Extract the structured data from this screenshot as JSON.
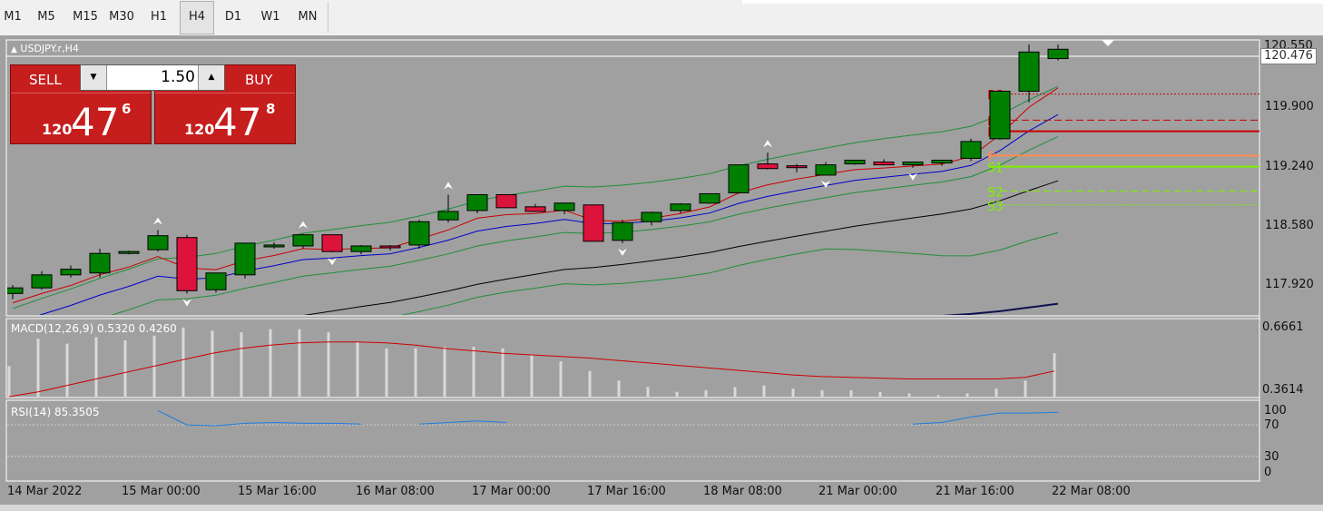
{
  "timeframes": [
    "M1",
    "M5",
    "M15",
    "M30",
    "H1",
    "H4",
    "D1",
    "W1",
    "MN"
  ],
  "active_timeframe": "H4",
  "chart": {
    "symbol_title": "USDJPY.r,H4",
    "current_price": "120.476",
    "top_price_partial": "120.550",
    "price_ticks": [
      "119.900",
      "119.240",
      "118.580",
      "117.920"
    ],
    "time_labels": [
      "14 Mar 2022",
      "15 Mar 00:00",
      "15 Mar 16:00",
      "16 Mar 08:00",
      "17 Mar 00:00",
      "17 Mar 16:00",
      "18 Mar 08:00",
      "21 Mar 00:00",
      "21 Mar 16:00",
      "22 Mar 08:00"
    ],
    "pivots": [
      "R3",
      "R2",
      "R1",
      "P",
      "S1",
      "S2",
      "S3"
    ]
  },
  "trade_panel": {
    "sell_label": "SELL",
    "buy_label": "BUY",
    "lot_size": "1.50",
    "sell_price_prefix": "120",
    "sell_price_big": "47",
    "sell_price_sup": "6",
    "buy_price_prefix": "120",
    "buy_price_big": "47",
    "buy_price_sup": "8"
  },
  "macd": {
    "label": "MACD(12,26,9) 0.5320 0.4260",
    "ticks": [
      "0.6661",
      "0.3614"
    ]
  },
  "rsi": {
    "label": "RSI(14) 85.3505",
    "ticks": [
      "100",
      "70",
      "30",
      "0"
    ]
  },
  "colors": {
    "bull": "#008000",
    "bear": "#dc143c",
    "background": "#a0a0a0",
    "accent": "#c61d1d"
  },
  "chart_data": {
    "type": "candlestick",
    "symbol": "USDJPY.r",
    "timeframe": "H4",
    "ohlc": [
      [
        117.88,
        117.97,
        117.82,
        117.94
      ],
      [
        117.94,
        118.12,
        117.92,
        118.08
      ],
      [
        118.08,
        118.18,
        118.05,
        118.14
      ],
      [
        118.1,
        118.36,
        118.05,
        118.31
      ],
      [
        118.31,
        118.34,
        118.3,
        118.33
      ],
      [
        118.35,
        118.56,
        118.33,
        118.5
      ],
      [
        118.48,
        118.51,
        117.88,
        117.91
      ],
      [
        117.92,
        118.08,
        117.89,
        118.1
      ],
      [
        118.08,
        118.42,
        118.04,
        118.42
      ],
      [
        118.38,
        118.43,
        118.36,
        118.4
      ],
      [
        118.39,
        118.52,
        118.36,
        118.51
      ],
      [
        118.51,
        118.51,
        118.32,
        118.33
      ],
      [
        118.33,
        118.4,
        118.3,
        118.39
      ],
      [
        118.39,
        118.4,
        118.34,
        118.38
      ],
      [
        118.4,
        118.67,
        118.36,
        118.65
      ],
      [
        118.67,
        118.94,
        118.64,
        118.76
      ],
      [
        118.77,
        118.94,
        118.74,
        118.94
      ],
      [
        118.94,
        118.94,
        118.8,
        118.8
      ],
      [
        118.81,
        118.84,
        118.76,
        118.76
      ],
      [
        118.77,
        118.85,
        118.73,
        118.85
      ],
      [
        118.83,
        118.82,
        118.47,
        118.44
      ],
      [
        118.45,
        118.67,
        118.42,
        118.64
      ],
      [
        118.65,
        118.76,
        118.61,
        118.75
      ],
      [
        118.77,
        118.85,
        118.74,
        118.84
      ],
      [
        118.85,
        118.95,
        118.84,
        118.95
      ],
      [
        118.96,
        119.23,
        118.95,
        119.26
      ],
      [
        119.27,
        119.39,
        119.21,
        119.22
      ],
      [
        119.25,
        119.27,
        119.18,
        119.23
      ],
      [
        119.15,
        119.29,
        119.15,
        119.26
      ],
      [
        119.27,
        119.31,
        119.26,
        119.31
      ],
      [
        119.29,
        119.32,
        119.26,
        119.26
      ],
      [
        119.26,
        119.29,
        119.23,
        119.29
      ],
      [
        119.28,
        119.31,
        119.25,
        119.31
      ],
      [
        119.33,
        119.54,
        119.3,
        119.51
      ],
      [
        119.54,
        119.99,
        119.53,
        120.05
      ],
      [
        120.05,
        120.55,
        119.93,
        120.47
      ],
      [
        120.4,
        120.55,
        120.38,
        120.5
      ]
    ],
    "pivot_levels": {
      "R3": 120.02,
      "R2": 119.74,
      "R1": 119.62,
      "P": 119.36,
      "S1": 119.24,
      "S2": 118.98,
      "S3": 118.83
    },
    "ylim": [
      117.64,
      120.6
    ],
    "macd": {
      "ylim": [
        0.26,
        0.74
      ]
    },
    "rsi": {
      "ylim": [
        0,
        100
      ],
      "levels": [
        70,
        30
      ]
    }
  }
}
